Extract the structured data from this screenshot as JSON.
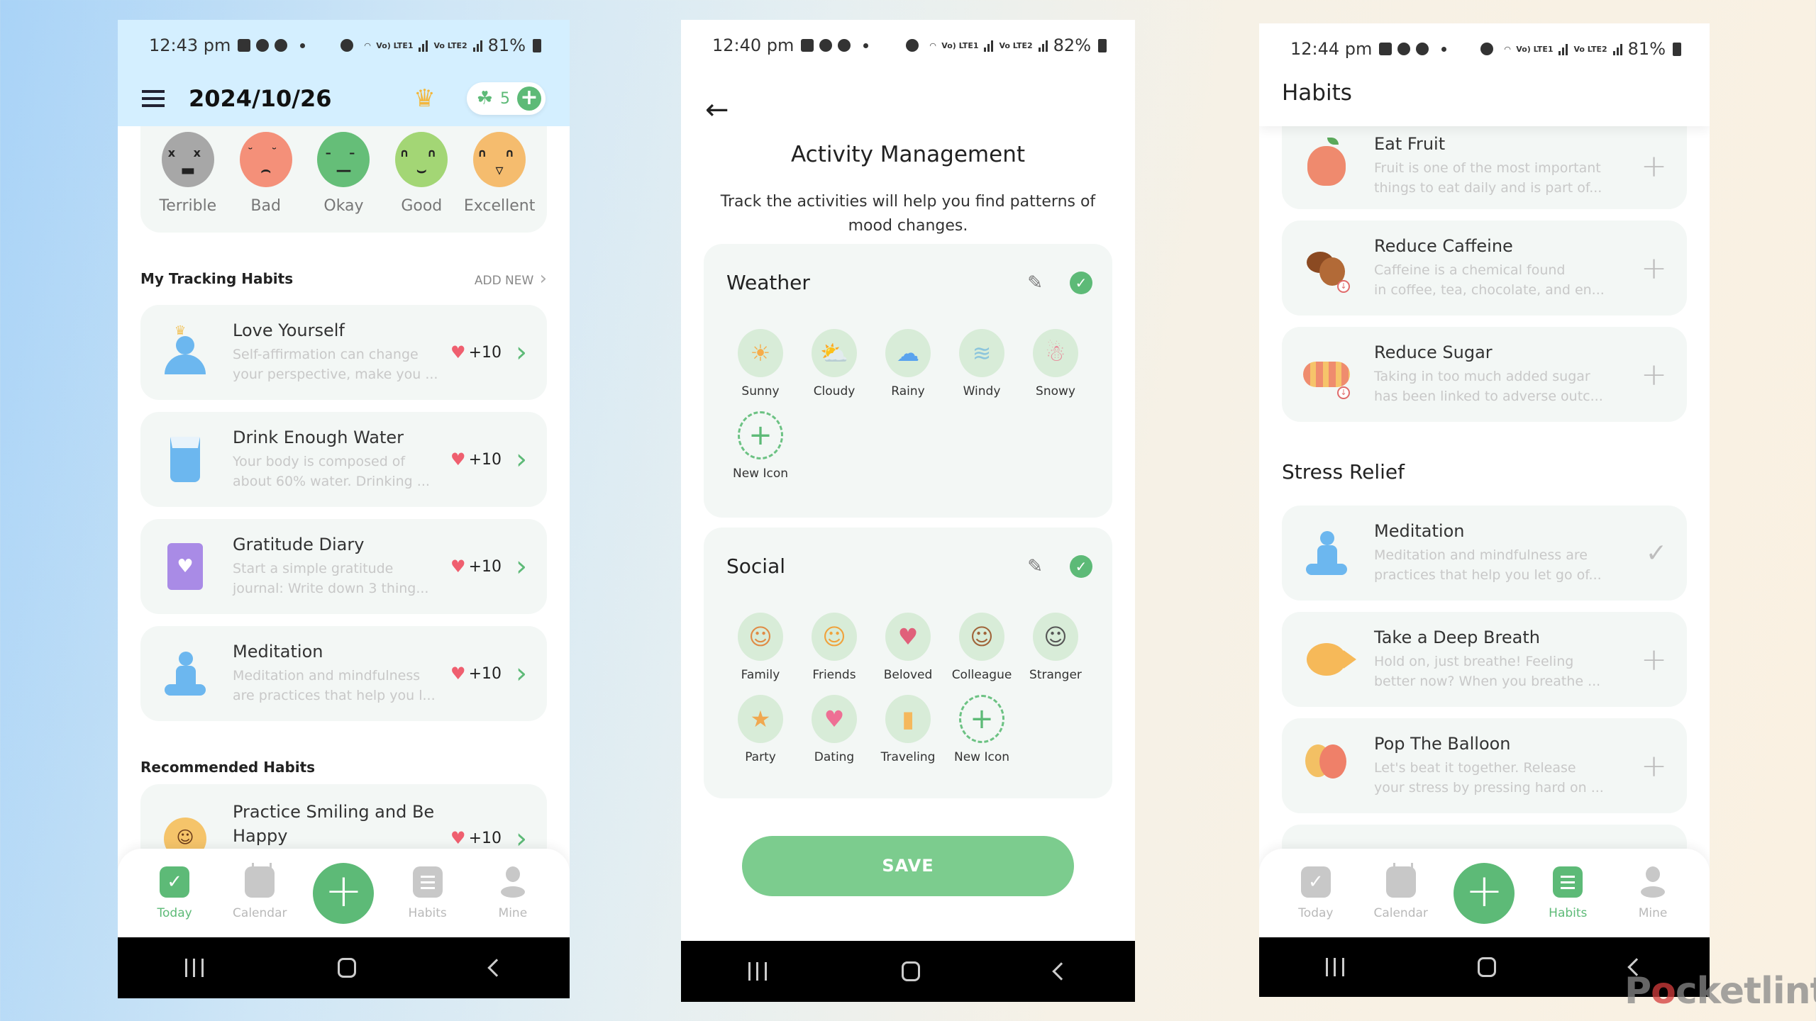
{
  "phones": {
    "today": {
      "status": {
        "time": "12:43 pm",
        "battery": "81%",
        "sim1": "Vo) LTE1",
        "sim2": "Vo LTE2"
      },
      "header": {
        "date": "2024/10/26",
        "menu_icon": "hamburger-icon",
        "premium_icon": "crown-icon",
        "clover_count": "5"
      },
      "moods": [
        {
          "label": "Terrible",
          "color": "#a7a7a7",
          "eyes": "x x",
          "mouth": "▬"
        },
        {
          "label": "Bad",
          "color": "#f49079",
          "eyes": "˘ ˘",
          "mouth": "⌢"
        },
        {
          "label": "Okay",
          "color": "#65be78",
          "eyes": "– –",
          "mouth": "—"
        },
        {
          "label": "Good",
          "color": "#a3d675",
          "eyes": "∩ ∩",
          "mouth": "⌣"
        },
        {
          "label": "Excellent",
          "color": "#f5bc6e",
          "eyes": "∩ ∩",
          "mouth": "▿"
        }
      ],
      "tracking": {
        "title": "My Tracking Habits",
        "add_new": "ADD NEW",
        "items": [
          {
            "title": "Love Yourself",
            "desc1": "Self-affirmation can change",
            "desc2": "your perspective, make you ...",
            "points": "+10"
          },
          {
            "title": "Drink Enough Water",
            "desc1": "Your body is composed of",
            "desc2": "about 60% water. Drinking ...",
            "points": "+10"
          },
          {
            "title": "Gratitude Diary",
            "desc1": "Start a simple gratitude",
            "desc2": "journal: Write down 3 thing...",
            "points": "+10"
          },
          {
            "title": "Meditation",
            "desc1": "Meditation and mindfulness",
            "desc2": "are practices that help you l...",
            "points": "+10"
          }
        ]
      },
      "recommended": {
        "title": "Recommended Habits",
        "items": [
          {
            "title": "Practice Smiling and Be Happy",
            "points": "+10"
          }
        ]
      },
      "tabs": [
        {
          "label": "Today",
          "active": true
        },
        {
          "label": "Calendar",
          "active": false
        },
        {
          "label": "Habits",
          "active": false
        },
        {
          "label": "Mine",
          "active": false
        }
      ]
    },
    "activity": {
      "status": {
        "time": "12:40 pm",
        "battery": "82%",
        "sim1": "Vo) LTE1",
        "sim2": "Vo LTE2"
      },
      "title": "Activity Management",
      "subtitle": "Track the activities will help you find patterns of mood changes.",
      "groups": [
        {
          "name": "Weather",
          "items": [
            {
              "label": "Sunny",
              "icon": "☀"
            },
            {
              "label": "Cloudy",
              "icon": "⛅"
            },
            {
              "label": "Rainy",
              "icon": "☁"
            },
            {
              "label": "Windy",
              "icon": "≋"
            },
            {
              "label": "Snowy",
              "icon": "☃"
            },
            {
              "label": "New Icon",
              "icon": "+"
            }
          ]
        },
        {
          "name": "Social",
          "items": [
            {
              "label": "Family",
              "icon": "☺"
            },
            {
              "label": "Friends",
              "icon": "☺"
            },
            {
              "label": "Beloved",
              "icon": "♥"
            },
            {
              "label": "Colleague",
              "icon": "☺"
            },
            {
              "label": "Stranger",
              "icon": "☺"
            },
            {
              "label": "Party",
              "icon": "★"
            },
            {
              "label": "Dating",
              "icon": "♥"
            },
            {
              "label": "Traveling",
              "icon": "▮"
            },
            {
              "label": "New Icon",
              "icon": "+"
            }
          ]
        }
      ],
      "save_label": "SAVE"
    },
    "habits": {
      "status": {
        "time": "12:44 pm",
        "battery": "81%",
        "sim1": "Vo) LTE1",
        "sim2": "Vo LTE2"
      },
      "title": "Habits",
      "items_top": [
        {
          "title": "Eat Fruit",
          "desc1": "Fruit is one of the most important",
          "desc2": "things to eat daily and is part of...",
          "action": "add"
        },
        {
          "title": "Reduce Caffeine",
          "desc1": "Caffeine is a chemical found",
          "desc2": "in coffee, tea, chocolate, and en...",
          "action": "add"
        },
        {
          "title": "Reduce Sugar",
          "desc1": "Taking in too much added sugar",
          "desc2": "has been linked to adverse outc...",
          "action": "add"
        }
      ],
      "stress_section": "Stress Relief",
      "items_stress": [
        {
          "title": "Meditation",
          "desc1": "Meditation and mindfulness are",
          "desc2": "practices that help you let go of...",
          "action": "added"
        },
        {
          "title": "Take a Deep Breath",
          "desc1": "Hold on, just breathe! Feeling",
          "desc2": "better now? When you breathe ...",
          "action": "add"
        },
        {
          "title": "Pop The Balloon",
          "desc1": "Let's beat it together. Release",
          "desc2": "your stress by pressing hard on ...",
          "action": "add"
        }
      ],
      "tabs": [
        {
          "label": "Today",
          "active": false
        },
        {
          "label": "Calendar",
          "active": false
        },
        {
          "label": "Habits",
          "active": true
        },
        {
          "label": "Mine",
          "active": false
        }
      ]
    }
  },
  "colors": {
    "accent": "#5dba77",
    "save": "#7ccc8e",
    "heart": "#ef5f6f"
  },
  "watermark": {
    "pre": "P",
    "o": "o",
    "post": "cketlint"
  }
}
